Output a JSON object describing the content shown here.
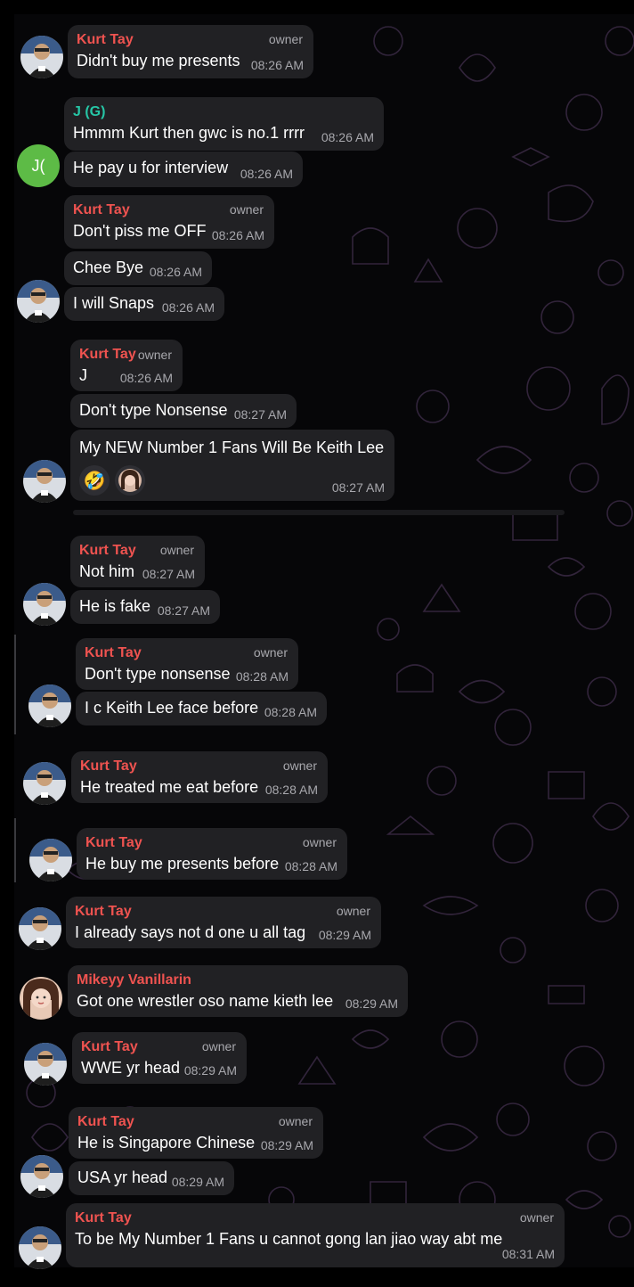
{
  "sender_kurt": "Kurt Tay",
  "sender_j": "J (G)",
  "sender_mikeyy": "Mikeyy Vanillarin",
  "role_owner": "owner",
  "avatar_j_initials": "J(",
  "messages": {
    "m1": {
      "text": "Didn't buy me presents",
      "time": "08:26 AM"
    },
    "m2": {
      "text": "Hmmm Kurt then gwc is no.1 rrrr",
      "time": "08:26 AM"
    },
    "m3": {
      "text": "He pay u for interview",
      "time": "08:26 AM"
    },
    "m4": {
      "text": "Don't piss me OFF",
      "time": "08:26 AM"
    },
    "m5": {
      "text": "Chee Bye",
      "time": "08:26 AM"
    },
    "m6": {
      "text": "I will Snaps",
      "time": "08:26 AM"
    },
    "m7": {
      "text": "J",
      "time": "08:26 AM"
    },
    "m8": {
      "text": "Don't type Nonsense",
      "time": "08:27 AM"
    },
    "m9": {
      "text": "My NEW Number 1 Fans Will Be Keith Lee",
      "time": "08:27 AM",
      "reaction_emoji": "🤣"
    },
    "m10": {
      "text": "Not him",
      "time": "08:27 AM"
    },
    "m11": {
      "text": "He is fake",
      "time": "08:27 AM"
    },
    "m12": {
      "text": "Don't type nonsense",
      "time": "08:28 AM"
    },
    "m13": {
      "text": "I c Keith Lee face before",
      "time": "08:28 AM"
    },
    "m14": {
      "text": "He treated me eat before",
      "time": "08:28 AM"
    },
    "m15": {
      "text": "He buy me presents before",
      "time": "08:28 AM"
    },
    "m16": {
      "text": "I already says not d one u all tag",
      "time": "08:29 AM"
    },
    "m17": {
      "text": "Got one wrestler oso name kieth lee",
      "time": "08:29 AM"
    },
    "m18": {
      "text": "WWE yr head",
      "time": "08:29 AM"
    },
    "m19": {
      "text": "He is Singapore Chinese",
      "time": "08:29 AM"
    },
    "m20": {
      "text": "USA yr head",
      "time": "08:29 AM"
    },
    "m21": {
      "text": "To be My Number 1 Fans u cannot gong lan jiao way abt me",
      "time": "08:31 AM"
    }
  },
  "colors": {
    "bubble": "#212124",
    "sender_red": "#ef5350",
    "sender_teal": "#26c6a6",
    "timestamp": "#a8a8ad",
    "avatar_green": "#5dbb46"
  }
}
